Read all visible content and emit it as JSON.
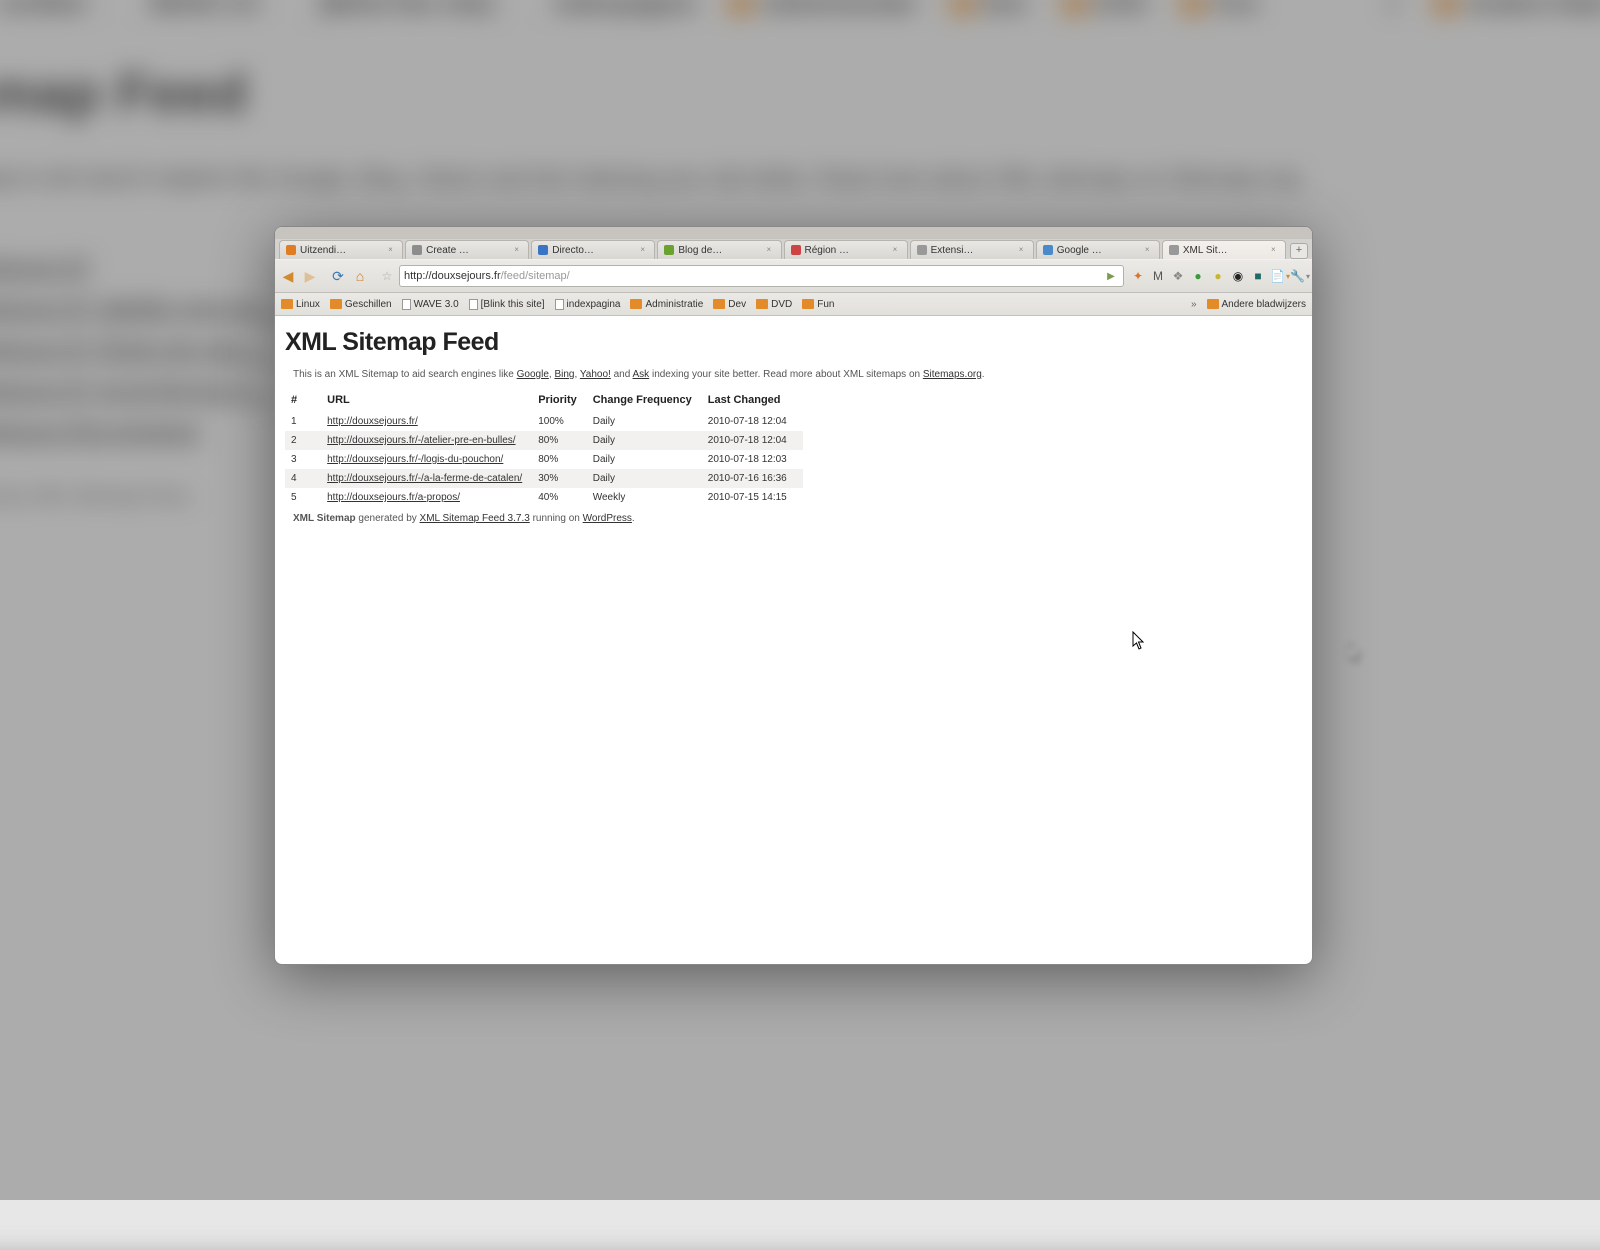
{
  "bg": {
    "h1": "…map Feed",
    "intro": "…map to aid search engines like Google, Bing, Yahoo! and Ask indexing your site better. Read more about XML sitemaps on Sitemaps.org.",
    "bookmarks": [
      "schillen",
      "WAVE 3.0",
      "[Blink this site]",
      "indexpagina",
      "Administratie",
      "Dev",
      "DVD",
      "Fun"
    ],
    "bookmarks_right": "Andere blad…",
    "list": [
      "…sejours.fr/",
      "…sejours.fr/   /atelier-pre-en…",
      "…sejours.fr/   /logis-du-pou…",
      "…sejours.fr/   /a-la-ferme-d…",
      "…sejours.fr/a-propos/"
    ],
    "footer": "…ated by XML Sitemap Feed…"
  },
  "tabs": [
    {
      "label": "Uitzendi…",
      "color": "#e07c22"
    },
    {
      "label": "Create …",
      "color": "#8d8d8d"
    },
    {
      "label": "Directo…",
      "color": "#3a74c4"
    },
    {
      "label": "Blog de…",
      "color": "#6aa22f"
    },
    {
      "label": "Région …",
      "color": "#c44"
    },
    {
      "label": "Extensi…",
      "color": "#999"
    },
    {
      "label": "Google …",
      "color": "#4a8acb"
    },
    {
      "label": "XML Sit…",
      "active": true,
      "color": "#999"
    }
  ],
  "newtab_glyph": "+",
  "address": {
    "prefix": "http://douxsejours.fr",
    "suffix": "/feed/sitemap/"
  },
  "bookmarks": [
    {
      "label": "Linux",
      "kind": "folder"
    },
    {
      "label": "Geschillen",
      "kind": "folder"
    },
    {
      "label": "WAVE 3.0",
      "kind": "page"
    },
    {
      "label": "[Blink this site]",
      "kind": "page"
    },
    {
      "label": "indexpagina",
      "kind": "page"
    },
    {
      "label": "Administratie",
      "kind": "folder"
    },
    {
      "label": "Dev",
      "kind": "folder"
    },
    {
      "label": "DVD",
      "kind": "folder"
    },
    {
      "label": "Fun",
      "kind": "folder"
    }
  ],
  "bookmarks_overflow": "»",
  "bookmarks_right": {
    "label": "Andere bladwijzers",
    "kind": "folder"
  },
  "page": {
    "title": "XML Sitemap Feed",
    "intro": {
      "pre": "This is an XML Sitemap to aid search engines like ",
      "links": [
        "Google",
        "Bing",
        "Yahoo!",
        "Ask"
      ],
      "sep1": ", ",
      "sep2": ", ",
      "sep3": " and ",
      "post": " indexing your site better. Read more about XML sitemaps on ",
      "last_link": "Sitemaps.org",
      "tail": "."
    },
    "columns": [
      "#",
      "URL",
      "Priority",
      "Change Frequency",
      "Last Changed"
    ],
    "rows": [
      {
        "n": "1",
        "url": "http://douxsejours.fr/",
        "prio": "100%",
        "freq": "Daily",
        "date": "2010-07-18 12:04"
      },
      {
        "n": "2",
        "url": "http://douxsejours.fr/-/atelier-pre-en-bulles/",
        "prio": "80%",
        "freq": "Daily",
        "date": "2010-07-18 12:04"
      },
      {
        "n": "3",
        "url": "http://douxsejours.fr/-/logis-du-pouchon/",
        "prio": "80%",
        "freq": "Daily",
        "date": "2010-07-18 12:03"
      },
      {
        "n": "4",
        "url": "http://douxsejours.fr/-/a-la-ferme-de-catalen/",
        "prio": "30%",
        "freq": "Daily",
        "date": "2010-07-16 16:36"
      },
      {
        "n": "5",
        "url": "http://douxsejours.fr/a-propos/",
        "prio": "40%",
        "freq": "Weekly",
        "date": "2010-07-15 14:15"
      }
    ],
    "footer": {
      "bold": "XML Sitemap",
      "mid1": " generated by ",
      "link1": "XML Sitemap Feed 3.7.3",
      "mid2": " running on ",
      "link2": "WordPress",
      "tail": "."
    }
  },
  "ext_icons": [
    {
      "glyph": "✦",
      "color": "#d7772f"
    },
    {
      "glyph": "M",
      "color": "#555",
      "bg": "none"
    },
    {
      "glyph": "❖",
      "color": "#888"
    },
    {
      "glyph": "●",
      "color": "#3b9b3b"
    },
    {
      "glyph": "●",
      "color": "#c8b62a"
    },
    {
      "glyph": "◉",
      "color": "#222"
    },
    {
      "glyph": "■",
      "color": "#1f6a67"
    }
  ],
  "nav": {
    "back": "◀",
    "fwd": "▶",
    "reload": "⟳",
    "home": "⌂",
    "star": "☆",
    "go": "▶",
    "pagemenu": "▾",
    "wrench": "🔧"
  }
}
